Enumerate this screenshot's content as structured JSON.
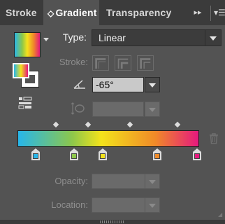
{
  "tabs": [
    {
      "label": "Stroke",
      "active": false
    },
    {
      "label": "Gradient",
      "active": true,
      "updown_glyph": "◇"
    },
    {
      "label": "Transparency",
      "active": false
    }
  ],
  "tab_overflow_glyph": "▸▸",
  "tab_menu_glyph": "▾☰",
  "type": {
    "label": "Type:",
    "value": "Linear"
  },
  "stroke": {
    "label": "Stroke:"
  },
  "angle": {
    "value": "-65°"
  },
  "opacity": {
    "label": "Opacity:",
    "value": ""
  },
  "location": {
    "label": "Location:",
    "value": ""
  },
  "gradient": {
    "stops": [
      {
        "color": "#27b6ea",
        "fraction": 0.1
      },
      {
        "color": "#8dc74b",
        "fraction": 0.31
      },
      {
        "color": "#f3e31b",
        "fraction": 0.47
      },
      {
        "color": "#f08a28",
        "fraction": 0.77
      },
      {
        "color": "#e6197e",
        "fraction": 0.99
      }
    ],
    "midpoints": [
      0.21,
      0.39,
      0.62,
      0.88
    ]
  },
  "icons": {
    "swatch_menu": "chevron-down-icon",
    "fill_stroke": "fill-stroke-icon",
    "reverse": "reverse-gradient-icon",
    "angle": "angle-icon",
    "aspect": "aspect-ratio-icon",
    "trash": "trash-icon"
  }
}
